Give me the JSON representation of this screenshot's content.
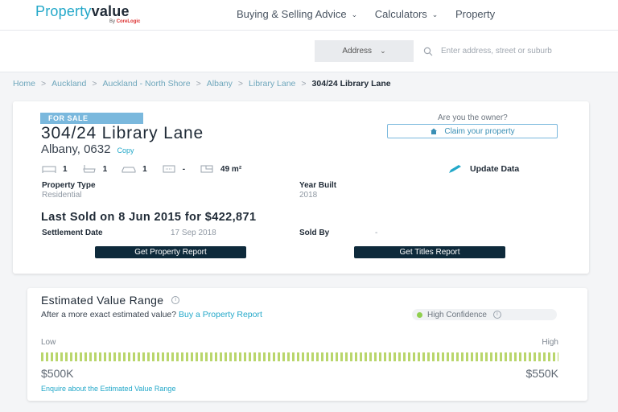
{
  "header": {
    "logo_part1": "Property",
    "logo_part2": "value",
    "logo_by": "By",
    "logo_brand": "CoreLogic",
    "nav": [
      {
        "label": "Buying & Selling Advice"
      },
      {
        "label": "Calculators"
      },
      {
        "label": "Property"
      }
    ]
  },
  "search": {
    "type_label": "Address",
    "placeholder": "Enter address, street or suburb"
  },
  "breadcrumb": {
    "items": [
      "Home",
      "Auckland",
      "Auckland - North Shore",
      "Albany",
      "Library Lane"
    ],
    "current": "304/24 Library Lane"
  },
  "property": {
    "status_badge": "FOR SALE",
    "address_line1": "304/24 Library Lane",
    "address_line2": "Albany, 0632",
    "copy_label": "Copy",
    "owner_question": "Are you the owner?",
    "claim_label": "Claim your property",
    "features": [
      {
        "icon": "bed-icon",
        "value": "1"
      },
      {
        "icon": "bath-icon",
        "value": "1"
      },
      {
        "icon": "car-icon",
        "value": "1"
      },
      {
        "icon": "land-icon",
        "value": "-"
      },
      {
        "icon": "floor-area-icon",
        "value": "49 m²"
      }
    ],
    "update_label": "Update Data",
    "property_type_label": "Property Type",
    "property_type_value": "Residential",
    "year_built_label": "Year Built",
    "year_built_value": "2018",
    "last_sold": "Last Sold on 8 Jun 2015 for $422,871",
    "settlement_label": "Settlement Date",
    "settlement_value": "17 Sep 2018",
    "sold_by_label": "Sold By",
    "sold_by_value": "-",
    "report_button": "Get Property Report",
    "titles_button": "Get Titles Report"
  },
  "estimate": {
    "title": "Estimated Value Range",
    "prompt": "After a more exact estimated value?",
    "prompt_link": "Buy a Property Report",
    "confidence": "High Confidence",
    "confidence_color": "#8fcf4e",
    "low_label": "Low",
    "high_label": "High",
    "low_value": "$500K",
    "high_value": "$550K",
    "range_fill_fraction": 1.0,
    "enquire_link": "Enquire about the Estimated Value Range"
  }
}
